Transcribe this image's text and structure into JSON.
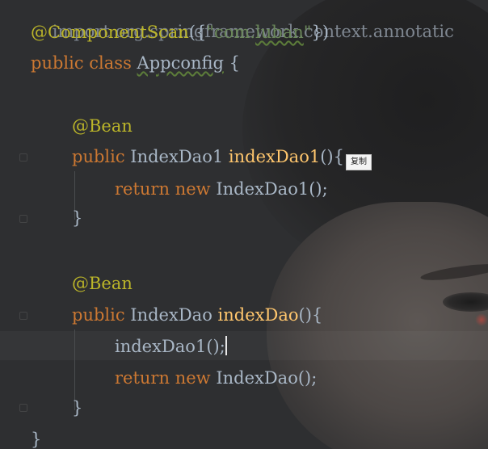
{
  "code": {
    "import_partial": "import org.springframework.context.annotatic",
    "component_scan_annotation": "@ComponentScan",
    "component_scan_open": "({",
    "component_scan_quote_open": "\"com.",
    "component_scan_package": "luban",
    "component_scan_quote_close": "\"",
    "component_scan_close": "})",
    "kw_public": "public",
    "kw_class": "class",
    "class_name": "Appconfig",
    "open_brace": "{",
    "bean_annotation": "@Bean",
    "method1_return_type": "IndexDao1",
    "method1_name": "indexDao1",
    "method1_params": "()",
    "method1_open": "{",
    "kw_return": "return",
    "kw_new": "new",
    "method1_body_call": "IndexDao1();",
    "close_brace": "}",
    "method2_return_type": "IndexDao",
    "method2_name": "indexDao",
    "method2_sig_tail": "(){",
    "method2_body_line1": "indexDao1();",
    "method2_body_call": "IndexDao();",
    "class_close": "}"
  },
  "tooltip": {
    "label": "复制"
  },
  "colors": {
    "annotation": "#bbb529",
    "keyword": "#cc7832",
    "method_name": "#ffc66d",
    "string": "#6a8759",
    "default_text": "#a9b7c6",
    "background": "#2e2f31"
  }
}
